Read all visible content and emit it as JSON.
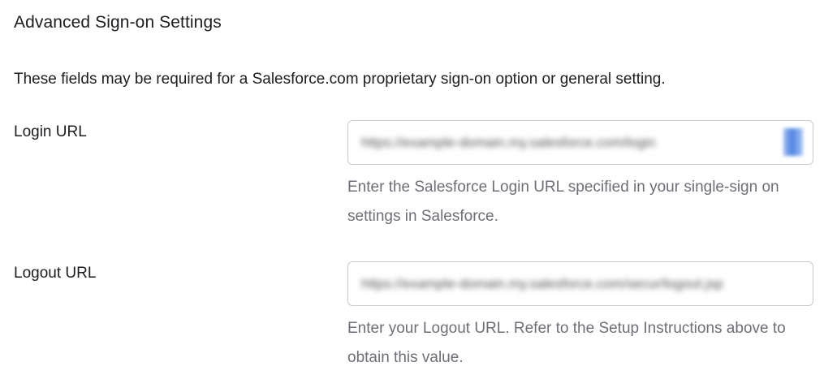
{
  "section": {
    "title": "Advanced Sign-on Settings",
    "description": "These fields may be required for a Salesforce.com proprietary sign-on option or general setting."
  },
  "fields": {
    "login_url": {
      "label": "Login URL",
      "value": "https://example-domain.my.salesforce.com/login",
      "help": "Enter the Salesforce Login URL specified in your single-sign on settings in Salesforce."
    },
    "logout_url": {
      "label": "Logout URL",
      "value": "https://example-domain.my.salesforce.com/secur/logout.jsp",
      "help": "Enter your Logout URL. Refer to the Setup Instructions above to obtain this value."
    }
  }
}
